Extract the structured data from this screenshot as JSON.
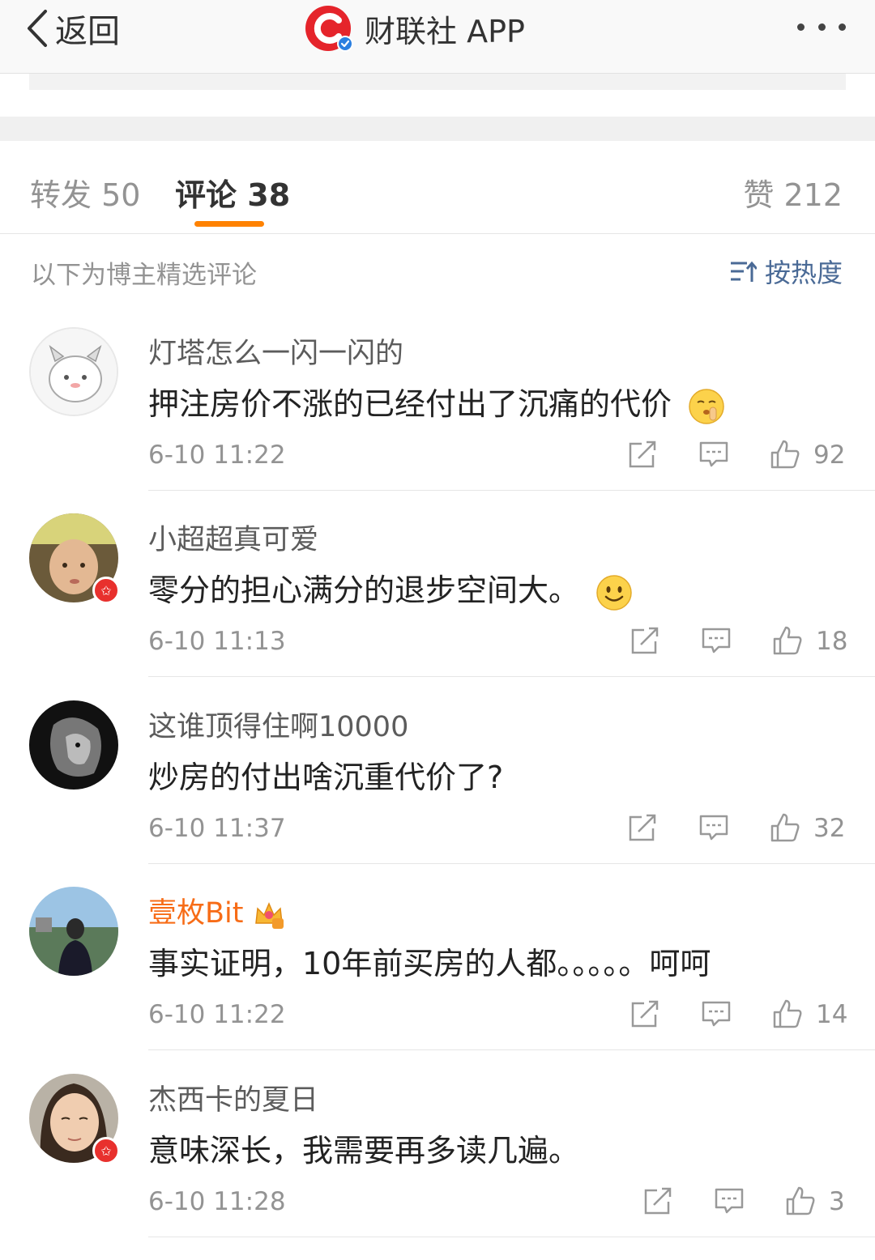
{
  "nav": {
    "back_label": "返回",
    "title": "财联社 APP"
  },
  "tabs": {
    "repost_label": "转发",
    "repost_count": "50",
    "comment_label": "评论",
    "comment_count": "38",
    "like_label": "赞",
    "like_count": "212"
  },
  "notice": "以下为博主精选评论",
  "sort_label": "按热度",
  "colors": {
    "accent": "#ff8200",
    "link": "#4a6a96",
    "vip_name": "#f76c17",
    "badge": "#e8302d"
  },
  "comments": [
    {
      "user": "灯塔怎么一闪一闪的",
      "text": "押注房价不涨的已经付出了沉痛的代价",
      "emoji": "shush-emoji-icon",
      "time": "6-10 11:22",
      "likes": "92"
    },
    {
      "user": "小超超真可爱",
      "text": "零分的担心满分的退步空间大。",
      "emoji": "smile-emoji-icon",
      "time": "6-10 11:13",
      "likes": "18"
    },
    {
      "user": "这谁顶得住啊10000",
      "text": "炒房的付出啥沉重代价了?",
      "time": "6-10 11:37",
      "likes": "32"
    },
    {
      "user": "壹枚Bit",
      "text": "事实证明，10年前买房的人都。。。。。呵呵",
      "time": "6-10 11:22",
      "likes": "14"
    },
    {
      "user": "杰西卡的夏日",
      "text": "意味深长，我需要再多读几遍。",
      "time": "6-10 11:28",
      "likes": "3"
    }
  ]
}
